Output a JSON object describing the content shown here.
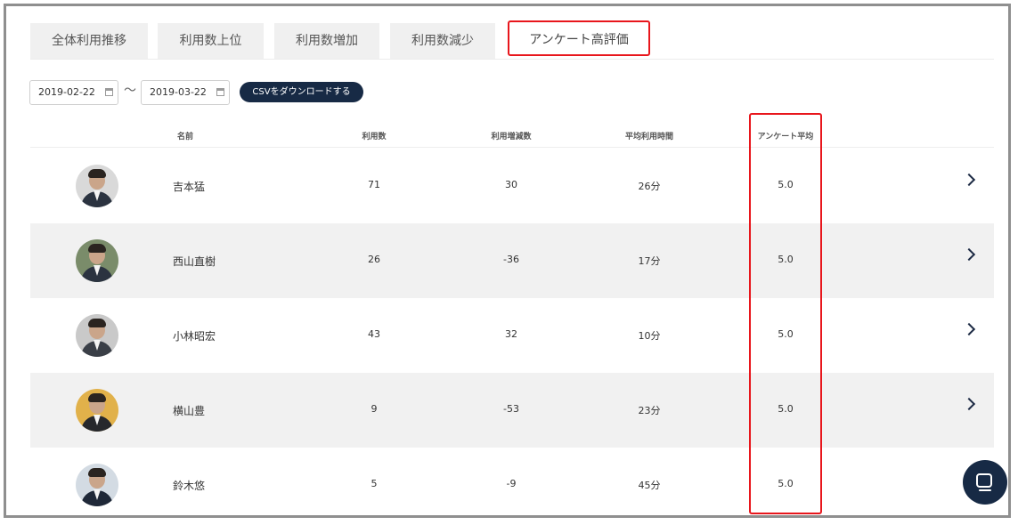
{
  "tabs": [
    {
      "label": "全体利用推移"
    },
    {
      "label": "利用数上位"
    },
    {
      "label": "利用数増加"
    },
    {
      "label": "利用数減少"
    },
    {
      "label": "アンケート高評価"
    }
  ],
  "filters": {
    "start_date": "2019-02-22",
    "end_date": "2019-03-22",
    "separator": "〜",
    "csv_button": "CSVをダウンロードする"
  },
  "table": {
    "headers": {
      "name": "名前",
      "usage": "利用数",
      "usage_change": "利用増減数",
      "avg_time": "平均利用時間",
      "survey_avg": "アンケート平均"
    },
    "rows": [
      {
        "name": "吉本猛",
        "usage": "71",
        "usage_change": "30",
        "avg_time": "26分",
        "survey_avg": "5.0"
      },
      {
        "name": "西山直樹",
        "usage": "26",
        "usage_change": "-36",
        "avg_time": "17分",
        "survey_avg": "5.0"
      },
      {
        "name": "小林昭宏",
        "usage": "43",
        "usage_change": "32",
        "avg_time": "10分",
        "survey_avg": "5.0"
      },
      {
        "name": "横山豊",
        "usage": "9",
        "usage_change": "-53",
        "avg_time": "23分",
        "survey_avg": "5.0"
      },
      {
        "name": "鈴木悠",
        "usage": "5",
        "usage_change": "-9",
        "avg_time": "45分",
        "survey_avg": "5.0"
      }
    ]
  },
  "colors": {
    "accent_navy": "#172a45",
    "highlight_red": "#e8161c"
  }
}
